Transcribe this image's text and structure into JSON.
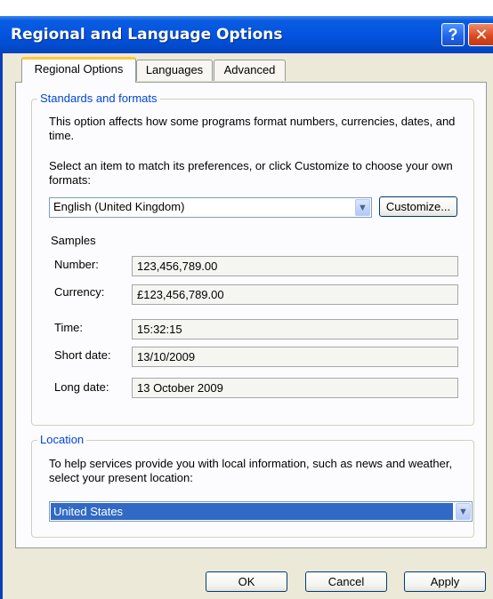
{
  "window": {
    "title": "Regional and Language Options",
    "help_glyph": "?",
    "close_glyph": "✕"
  },
  "tabs": [
    {
      "label": "Regional Options",
      "active": true
    },
    {
      "label": "Languages",
      "active": false
    },
    {
      "label": "Advanced",
      "active": false
    }
  ],
  "standards": {
    "legend": "Standards and formats",
    "description": "This option affects how some programs format numbers, currencies, dates, and time.",
    "select_prompt": "Select an item to match its preferences, or click Customize to choose your own formats:",
    "selected_format": "English (United Kingdom)",
    "customize_label": "Customize..."
  },
  "samples": {
    "heading": "Samples",
    "rows": [
      {
        "label": "Number:",
        "value": "123,456,789.00"
      },
      {
        "label": "Currency:",
        "value": "£123,456,789.00"
      },
      {
        "label": "Time:",
        "value": "15:32:15"
      },
      {
        "label": "Short date:",
        "value": "13/10/2009"
      },
      {
        "label": "Long date:",
        "value": "13 October 2009"
      }
    ]
  },
  "location": {
    "legend": "Location",
    "description": "To help services provide you with local information, such as news and weather, select your present location:",
    "selected": "United States"
  },
  "footer": {
    "ok_label": "OK",
    "cancel_label": "Cancel",
    "apply_label": "Apply"
  },
  "icons": {
    "dropdown_arrow": "chevron-down-icon"
  },
  "colors": {
    "titlebar_blue": "#0454e0",
    "legend_blue": "#0046d5",
    "selection_blue": "#316ac5",
    "active_tab_accent": "#ffc83c",
    "dialog_bg": "#ece9d8"
  }
}
